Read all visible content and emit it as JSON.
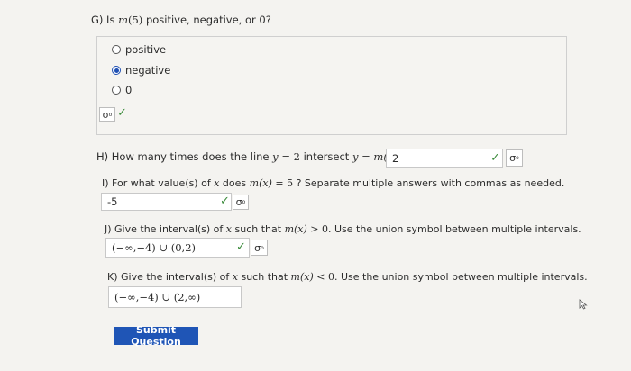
{
  "g": {
    "prefix": "G) Is ",
    "m": "m",
    "arg": "(5)",
    "suffix": " positive, negative, or 0?",
    "options": [
      {
        "label": "positive",
        "selected": false
      },
      {
        "label": "negative",
        "selected": true
      },
      {
        "label": "0",
        "selected": false
      }
    ],
    "icon": "sigma-icon",
    "status": "✓"
  },
  "h": {
    "prefix": "H) How many times does the line ",
    "y": "y",
    "eq": " = ",
    "two": "2",
    "mid": " intersect ",
    "y2": "y",
    "eq2": " = ",
    "mx": "m(x)",
    "suffix": " ?",
    "answer": "2",
    "status": "✓",
    "icon": "sigma-icon"
  },
  "i": {
    "prefix": "I) For what value(s) of ",
    "x": "x",
    "mid": " does ",
    "mx": "m(x)",
    "eq": " = 5",
    "suffix": " ? Separate multiple answers with commas as needed.",
    "answer": "-5",
    "status": "✓",
    "icon": "sigma-icon"
  },
  "j": {
    "prefix": "J) Give the interval(s) of ",
    "x": "x",
    "mid": " such that ",
    "mx": "m(x)",
    "rel": " > 0",
    "suffix": ". Use the union symbol between multiple intervals.",
    "answer": "(−∞,−4) ∪ (0,2)",
    "status": "✓",
    "icon": "sigma-icon"
  },
  "k": {
    "prefix": "K) Give the interval(s) of ",
    "x": "x",
    "mid": " such that ",
    "mx": "m(x)",
    "rel": " < 0",
    "suffix": ". Use the union symbol between multiple intervals.",
    "answer": "(−∞,−4) ∪ (2,∞)"
  },
  "submit_label": "Submit Question",
  "colors": {
    "accent": "#1f55b6",
    "check": "#3c8c3c"
  }
}
